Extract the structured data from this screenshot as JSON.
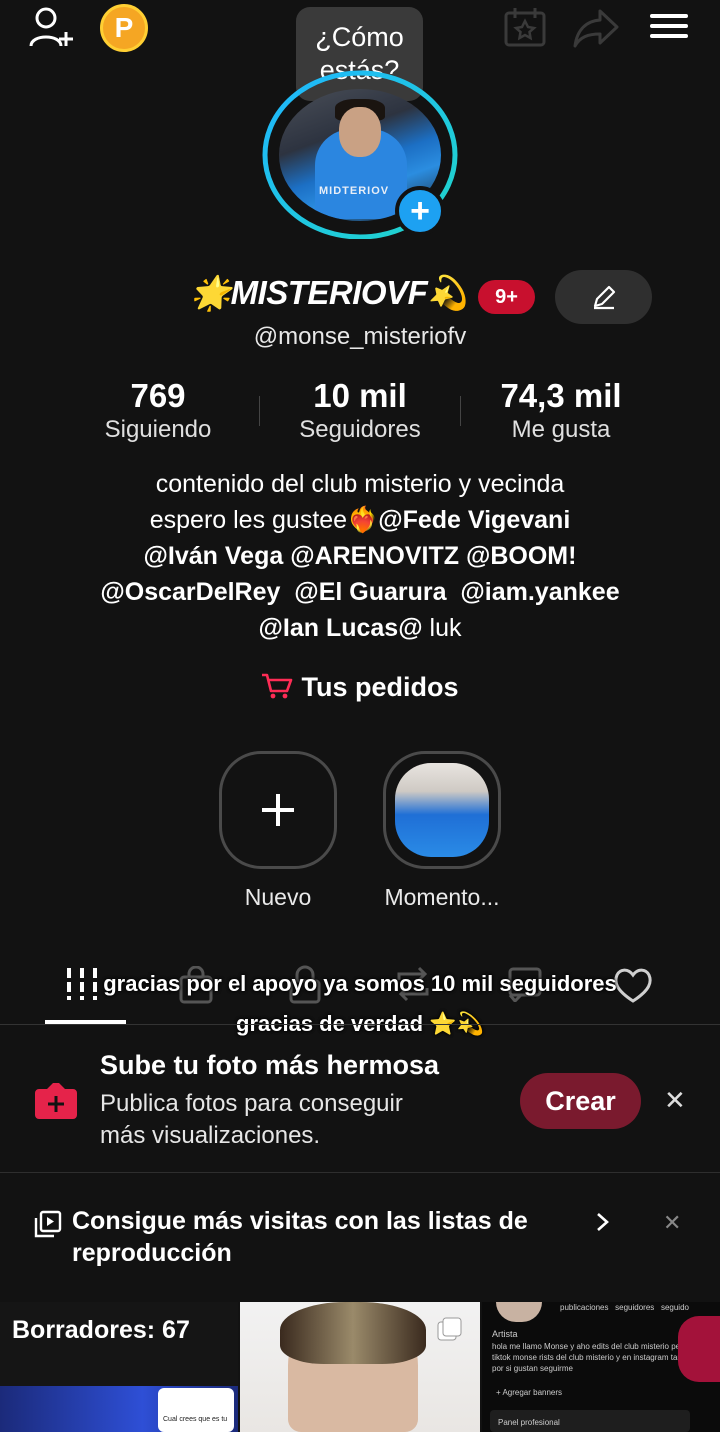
{
  "header": {
    "coin_letter": "P",
    "bubble_text": "¿Cómo estás?"
  },
  "profile": {
    "display_name": "🌟MISTERIOVF💫",
    "notifications_badge": "9+",
    "username": "@monse_misteriofv",
    "avatar_overlay_text": "MIDTERIOV"
  },
  "stats": [
    {
      "value": "769",
      "label": "Siguiendo"
    },
    {
      "value": "10 mil",
      "label": "Seguidores"
    },
    {
      "value": "74,3 mil",
      "label": "Me gusta"
    }
  ],
  "bio": {
    "line1": "contenido del club misterio y vecinda",
    "line2a": "espero les gustee❤️‍🔥",
    "line2b": "@Fede Vigevani",
    "line3": "@Iván Vega @ARENOVITZ @BOOM!",
    "line4": "@OscarDelRey  @El Guarura  @iam.yankee",
    "line5a": "@Ian Lucas@",
    "line5b": " luk"
  },
  "orders": {
    "label": "Tus pedidos"
  },
  "highlights": [
    {
      "label": "Nuevo"
    },
    {
      "label": "Momento..."
    }
  ],
  "caption": {
    "line1": "gracias por el apoyo ya somos 10 mil seguidores",
    "line2": "gracias de verdad ⭐💫"
  },
  "promo": {
    "title": "Sube tu foto más hermosa",
    "subtitle_line1": "Publica fotos para conseguir",
    "subtitle_line2": "más visualizaciones.",
    "button": "Crear",
    "close": "✕"
  },
  "playlist_banner": {
    "line1": "Consigue más visitas con las listas de",
    "line2": "reproducción",
    "close": "✕"
  },
  "grid": {
    "drafts_label": "Borradores: 67",
    "tile3": {
      "stats_labels": "publicaciones   seguidores   seguido",
      "role": "Artista",
      "bio": "hola me llamo Monse  y aho edits del club misterio pero en tiktok monse rists del club misterio y en instagram también por si gustan seguirme",
      "banners": "+ Agregar banners",
      "panel": "Panel profesional"
    },
    "tile1_chat": "Cual crees que es tu"
  },
  "colors": {
    "background": "#121212",
    "accent_red": "#fe2c55",
    "ring_blue": "#1da1f2",
    "coin": "#f5a623"
  }
}
